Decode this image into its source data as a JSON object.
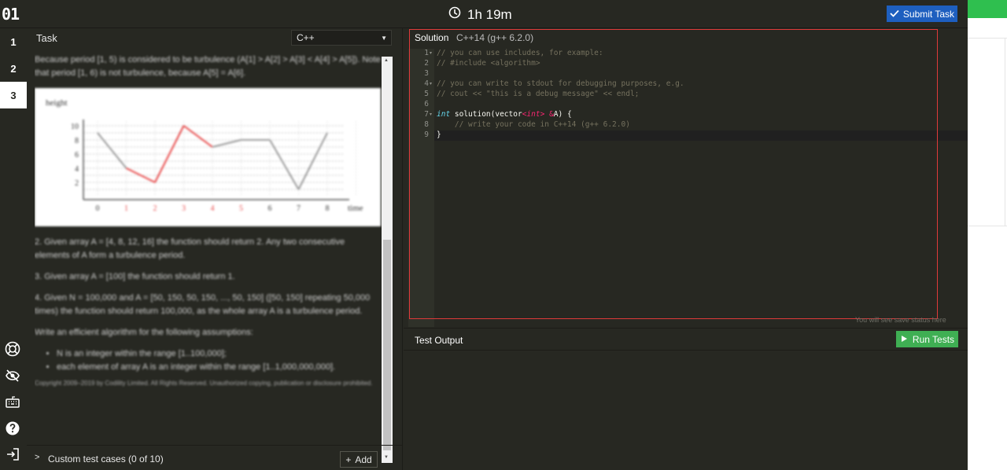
{
  "topbar": {
    "logo": "01",
    "timer": "1h 19m",
    "submit_label": "Submit Task"
  },
  "rail": {
    "tasks": [
      "1",
      "2",
      "3"
    ],
    "active_task": "3"
  },
  "task": {
    "header": "Task",
    "language": "C++",
    "para_intro": "Because period [1, 5) is considered to be turbulence (A[1] > A[2] > A[3] < A[4] > A[5]). Note that period [1, 6) is not turbulence, because A[5] = A[6].",
    "chart_ylabel": "height",
    "chart_xlabel": "time",
    "chart_yticks": [
      "10",
      "8",
      "6",
      "4",
      "2"
    ],
    "chart_xticks": [
      "0",
      "1",
      "2",
      "3",
      "4",
      "5",
      "6",
      "7",
      "8"
    ],
    "para_example2": "2. Given array A = [4, 8, 12, 16] the function should return 2. Any two consecutive elements of A form a turbulence period.",
    "para_example3": "3. Given array A = [100] the function should return 1.",
    "para_example4": "4. Given N = 100,000 and A = [50, 150, 50, 150, ..., 50, 150] ([50, 150] repeating 50,000 times) the function should return 100,000, as the whole array A is a turbulence period.",
    "para_assumptions": "Write an efficient algorithm for the following assumptions:",
    "bullets": [
      "N is an integer within the range [1..100,000];",
      "each element of array A is an integer within the range [1..1,000,000,000]."
    ],
    "copyright": "Copyright 2009–2019 by Codility Limited. All Rights Reserved. Unauthorized copying, publication or disclosure prohibited."
  },
  "custom_tests": {
    "label": "Custom test cases (0 of 10)",
    "add_label": "Add"
  },
  "editor": {
    "solution_label": "Solution",
    "language_version": "C++14 (g++ 6.2.0)",
    "line_numbers": [
      "1",
      "2",
      "3",
      "4",
      "5",
      "6",
      "7",
      "8",
      "9"
    ],
    "lines": {
      "l1": "// you can use includes, for example:",
      "l2": "// #include <algorithm>",
      "l4": "// you can write to stdout for debugging purposes, e.g.",
      "l5": "// cout << \"this is a debug message\" << endl;",
      "l7_kw": "int",
      "l7_a": " solution(vector",
      "l7_lt": "<",
      "l7_ty": "int",
      "l7_gt": ">",
      "l7_b": " ",
      "l7_amp": "&",
      "l7_c": "A) {",
      "l8": "    // write your code in C++14 (g++ 6.2.0)",
      "l9": "}"
    },
    "save_status": "You will see save status here"
  },
  "test_output": {
    "label": "Test Output",
    "run_label": "Run Tests"
  },
  "chart_data": {
    "type": "line",
    "x": [
      0,
      1,
      2,
      3,
      4,
      5,
      6,
      7,
      8
    ],
    "values": [
      9,
      4,
      2,
      10,
      7,
      8,
      8,
      1,
      9
    ],
    "turbulent_range": [
      1,
      5
    ],
    "xlabel": "time",
    "ylabel": "height",
    "ylim": [
      0,
      10
    ],
    "colors": {
      "normal": "#999999",
      "turbulent": "#e84a4a"
    }
  }
}
